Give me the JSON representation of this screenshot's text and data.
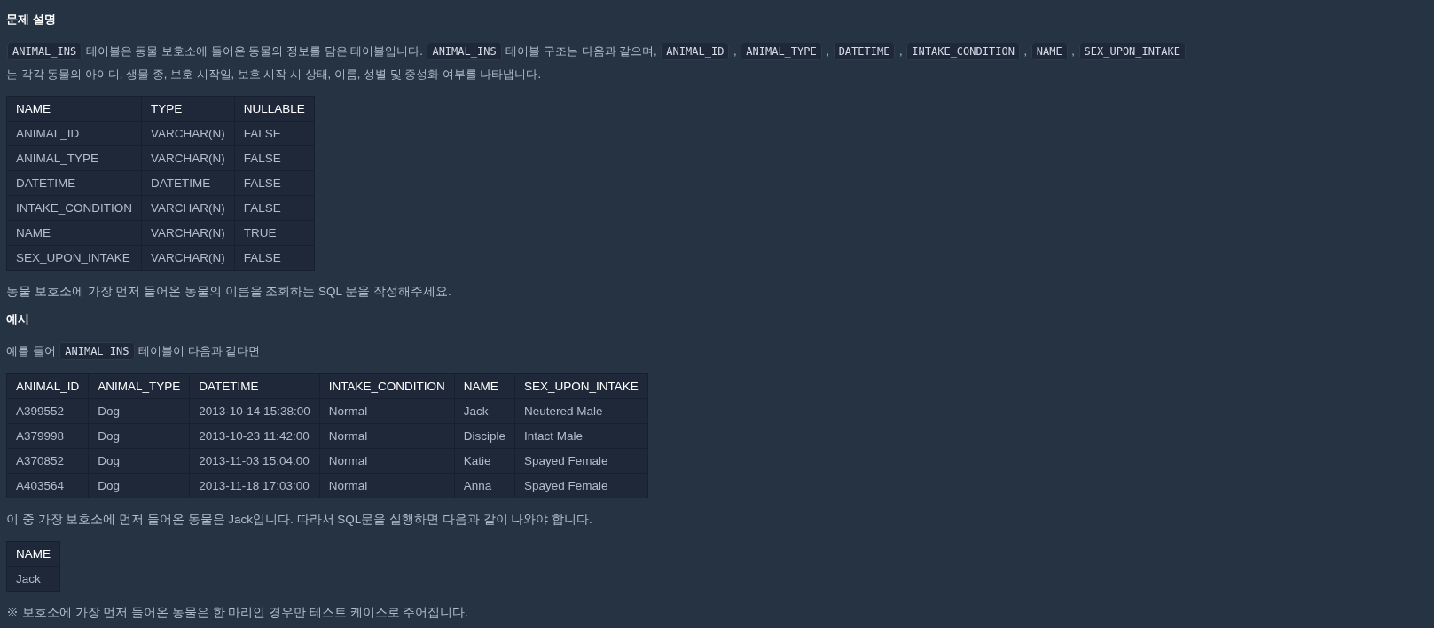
{
  "heading": "문제 설명",
  "intro": [
    {
      "kind": "code",
      "text": "ANIMAL_INS"
    },
    {
      "kind": "text",
      "text": "테이블은 동물 보호소에 들어온 동물의 정보를 담은 테이블입니다."
    },
    {
      "kind": "code",
      "text": "ANIMAL_INS"
    },
    {
      "kind": "text",
      "text": "테이블 구조는 다음과 같으며,"
    },
    {
      "kind": "code",
      "text": "ANIMAL_ID"
    },
    {
      "kind": "text",
      "text": ","
    },
    {
      "kind": "code",
      "text": "ANIMAL_TYPE"
    },
    {
      "kind": "text",
      "text": ","
    },
    {
      "kind": "code",
      "text": "DATETIME"
    },
    {
      "kind": "text",
      "text": ","
    },
    {
      "kind": "code",
      "text": "INTAKE_CONDITION"
    },
    {
      "kind": "text",
      "text": ","
    },
    {
      "kind": "code",
      "text": "NAME"
    },
    {
      "kind": "text",
      "text": ","
    },
    {
      "kind": "code",
      "text": "SEX_UPON_INTAKE"
    },
    {
      "kind": "text",
      "text": "는 각각 동물의 아이디, 생물 종, 보호 시작일, 보호 시작 시 상태,"
    },
    {
      "kind": "text",
      "text": "이름, 성별 및 중성화 여부를 나타냅니다."
    }
  ],
  "schema_table": {
    "columns": [
      "NAME",
      "TYPE",
      "NULLABLE"
    ],
    "rows": [
      [
        "ANIMAL_ID",
        "VARCHAR(N)",
        "FALSE"
      ],
      [
        "ANIMAL_TYPE",
        "VARCHAR(N)",
        "FALSE"
      ],
      [
        "DATETIME",
        "DATETIME",
        "FALSE"
      ],
      [
        "INTAKE_CONDITION",
        "VARCHAR(N)",
        "FALSE"
      ],
      [
        "NAME",
        "VARCHAR(N)",
        "TRUE"
      ],
      [
        "SEX_UPON_INTAKE",
        "VARCHAR(N)",
        "FALSE"
      ]
    ]
  },
  "task": "동물 보호소에 가장 먼저 들어온 동물의 이름을 조회하는 SQL 문을 작성해주세요.",
  "example_heading": "예시",
  "example_intro": [
    {
      "kind": "text",
      "text": "예를 들어"
    },
    {
      "kind": "code",
      "text": "ANIMAL_INS"
    },
    {
      "kind": "text",
      "text": "테이블이 다음과 같다면"
    }
  ],
  "example_table": {
    "columns": [
      "ANIMAL_ID",
      "ANIMAL_TYPE",
      "DATETIME",
      "INTAKE_CONDITION",
      "NAME",
      "SEX_UPON_INTAKE"
    ],
    "rows": [
      [
        "A399552",
        "Dog",
        "2013-10-14 15:38:00",
        "Normal",
        "Jack",
        "Neutered Male"
      ],
      [
        "A379998",
        "Dog",
        "2013-10-23 11:42:00",
        "Normal",
        "Disciple",
        "Intact Male"
      ],
      [
        "A370852",
        "Dog",
        "2013-11-03 15:04:00",
        "Normal",
        "Katie",
        "Spayed Female"
      ],
      [
        "A403564",
        "Dog",
        "2013-11-18 17:03:00",
        "Normal",
        "Anna",
        "Spayed Female"
      ]
    ]
  },
  "result_text": "이 중 가장 보호소에 먼저 들어온 동물은 Jack입니다. 따라서 SQL문을 실행하면 다음과 같이 나와야 합니다.",
  "result_table": {
    "columns": [
      "NAME"
    ],
    "rows": [
      [
        "Jack"
      ]
    ]
  },
  "note": "※ 보호소에 가장 먼저 들어온 동물은 한 마리인 경우만 테스트 케이스로 주어집니다."
}
